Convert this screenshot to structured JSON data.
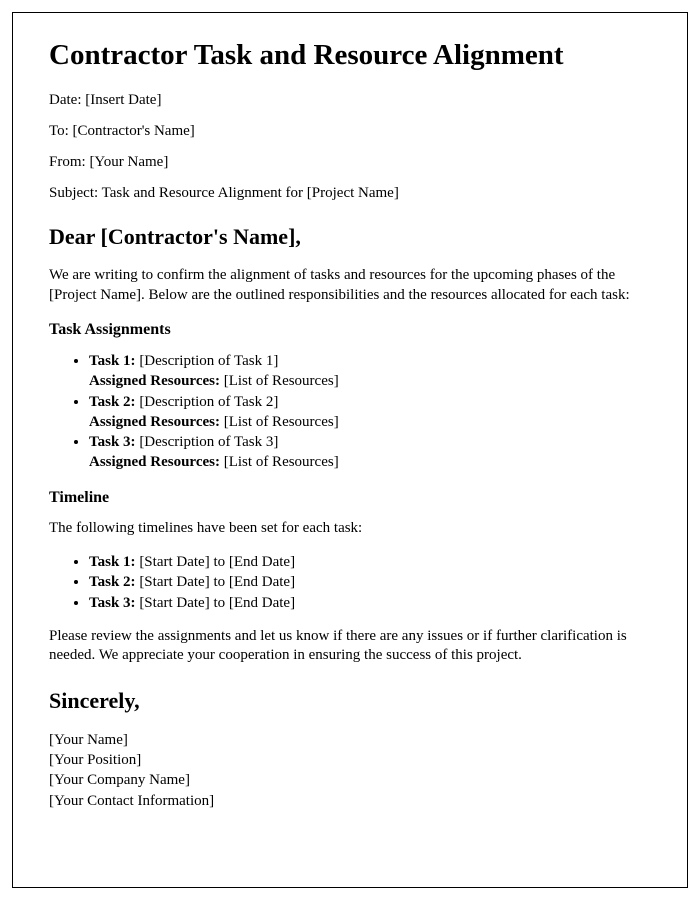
{
  "title": "Contractor Task and Resource Alignment",
  "meta": {
    "date_label": "Date: ",
    "date_value": "[Insert Date]",
    "to_label": "To: ",
    "to_value": "[Contractor's Name]",
    "from_label": "From: ",
    "from_value": "[Your Name]",
    "subject_label": "Subject: ",
    "subject_value": "Task and Resource Alignment for [Project Name]"
  },
  "salutation": "Dear [Contractor's Name],",
  "intro_paragraph": "We are writing to confirm the alignment of tasks and resources for the upcoming phases of the [Project Name]. Below are the outlined responsibilities and the resources allocated for each task:",
  "task_section": {
    "heading": "Task Assignments",
    "tasks": [
      {
        "label": "Task 1: ",
        "desc": "[Description of Task 1]",
        "assigned_label": "Assigned Resources: ",
        "assigned_value": "[List of Resources]"
      },
      {
        "label": "Task 2: ",
        "desc": "[Description of Task 2]",
        "assigned_label": "Assigned Resources: ",
        "assigned_value": "[List of Resources]"
      },
      {
        "label": "Task 3: ",
        "desc": "[Description of Task 3]",
        "assigned_label": "Assigned Resources: ",
        "assigned_value": "[List of Resources]"
      }
    ]
  },
  "timeline_section": {
    "heading": "Timeline",
    "intro": "The following timelines have been set for each task:",
    "timelines": [
      {
        "label": "Task 1: ",
        "range": "[Start Date] to [End Date]"
      },
      {
        "label": "Task 2: ",
        "range": "[Start Date] to [End Date]"
      },
      {
        "label": "Task 3: ",
        "range": "[Start Date] to [End Date]"
      }
    ]
  },
  "closing_paragraph": "Please review the assignments and let us know if there are any issues or if further clarification is needed. We appreciate your cooperation in ensuring the success of this project.",
  "signoff": "Sincerely,",
  "signature": {
    "name": "[Your Name]",
    "position": "[Your Position]",
    "company": "[Your Company Name]",
    "contact": "[Your Contact Information]"
  }
}
